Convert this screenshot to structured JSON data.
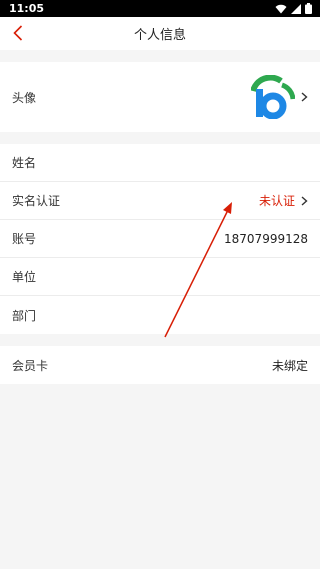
{
  "status_bar": {
    "time": "11:05"
  },
  "header": {
    "title": "个人信息"
  },
  "profile": {
    "avatar_label": "头像"
  },
  "info": {
    "name_label": "姓名",
    "name_value": "",
    "verify_label": "实名认证",
    "verify_value": "未认证",
    "account_label": "账号",
    "account_value": "18707999128",
    "company_label": "单位",
    "company_value": "",
    "department_label": "部门",
    "department_value": ""
  },
  "membership": {
    "card_label": "会员卡",
    "card_value": "未绑定"
  },
  "colors": {
    "accent_red": "#d81e06",
    "logo_blue": "#1e88e5",
    "logo_green": "#2ea84f"
  }
}
